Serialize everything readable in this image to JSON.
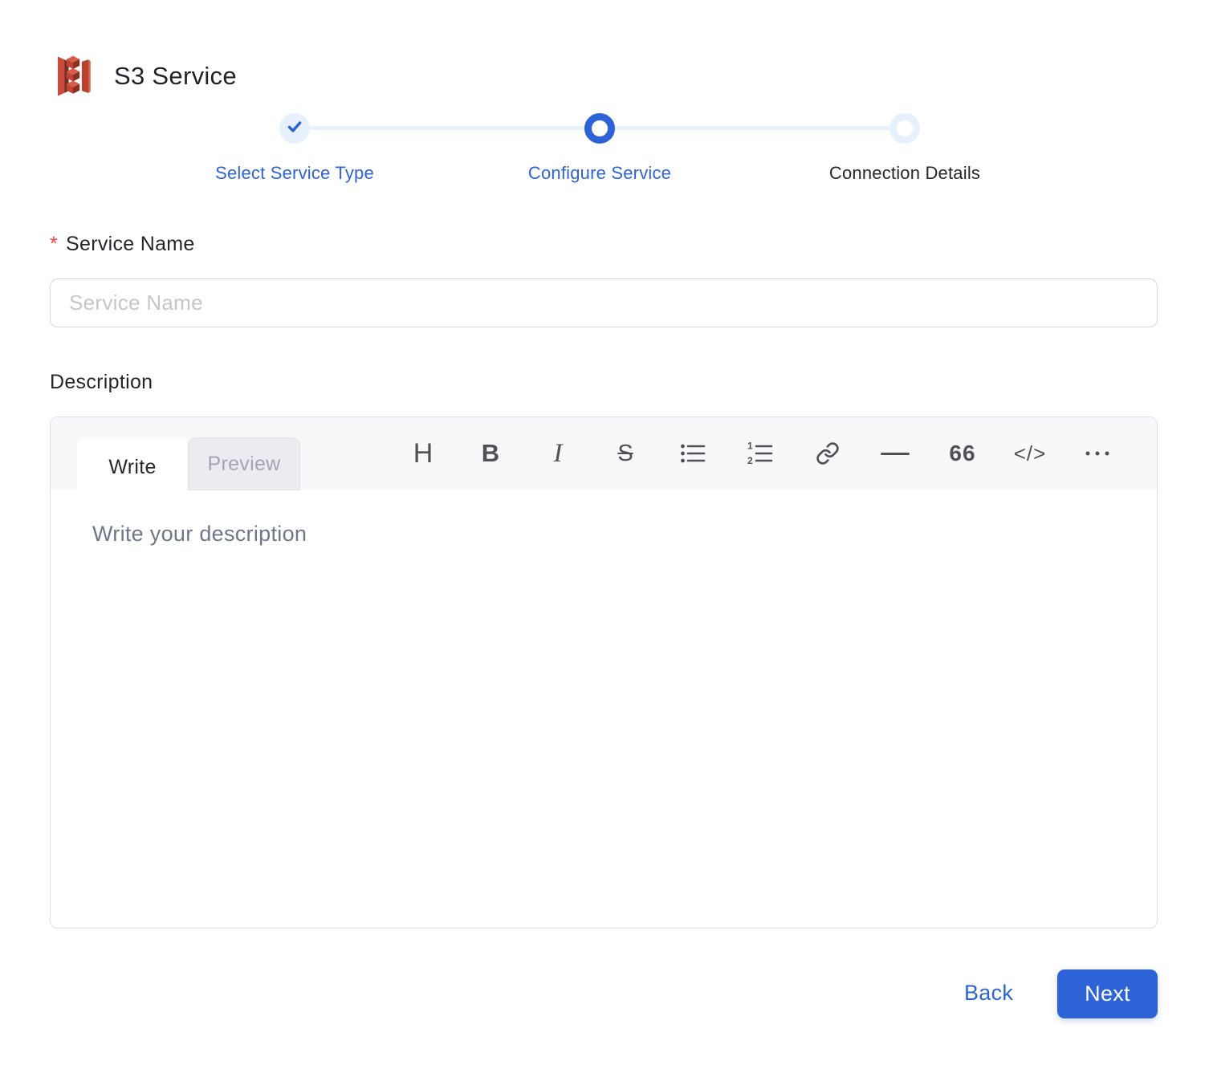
{
  "colors": {
    "primary_blue": "#2E63D8",
    "light_blue_track": "#E9F1FC",
    "completed_dot_bg": "#E7F0FC",
    "required_red": "#F4443B",
    "toolbar_icon_gray": "#4E5156",
    "s3_red_light": "#C94C3C",
    "s3_red_dark": "#7F2B1E"
  },
  "header": {
    "title": "S3 Service",
    "logo_icon": "s3-bucket-icon"
  },
  "stepper": {
    "steps": [
      {
        "label": "Select Service Type",
        "state": "completed",
        "icon": "check-icon"
      },
      {
        "label": "Configure Service",
        "state": "active"
      },
      {
        "label": "Connection Details",
        "state": "pending"
      }
    ]
  },
  "form": {
    "service_name": {
      "label": "Service Name",
      "required_marker": "*",
      "value": "",
      "placeholder": "Service Name"
    },
    "description": {
      "label": "Description",
      "editor": {
        "tabs": [
          {
            "label": "Write",
            "active": true
          },
          {
            "label": "Preview",
            "active": false
          }
        ],
        "toolbar": [
          {
            "name": "heading",
            "glyph": "H"
          },
          {
            "name": "bold",
            "glyph": "B"
          },
          {
            "name": "italic",
            "glyph": "I"
          },
          {
            "name": "strikethrough",
            "glyph": "S"
          },
          {
            "name": "unordered-list"
          },
          {
            "name": "ordered-list"
          },
          {
            "name": "link"
          },
          {
            "name": "horizontal-rule"
          },
          {
            "name": "quote",
            "glyph": "66"
          },
          {
            "name": "code",
            "glyph": "</>"
          },
          {
            "name": "more-options"
          }
        ],
        "value": "",
        "placeholder": "Write your description"
      }
    }
  },
  "footer": {
    "back_label": "Back",
    "next_label": "Next"
  }
}
